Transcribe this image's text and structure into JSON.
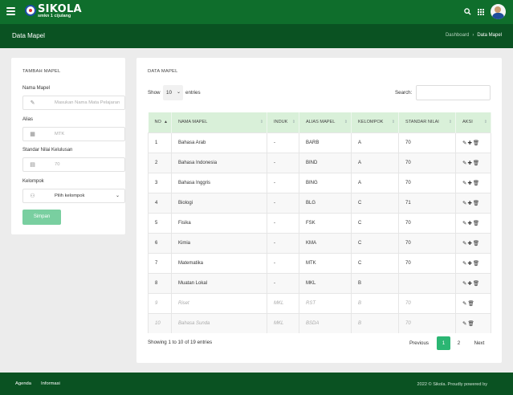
{
  "header": {
    "brand_title": "SIKOLA",
    "brand_subtitle": "smkn 1 cijulang"
  },
  "subheader": {
    "page_title": "Data Mapel",
    "breadcrumb": [
      "Dashboard",
      "Data Mapel"
    ]
  },
  "form": {
    "title": "TAMBAH MAPEL",
    "nama_label": "Nama Mapel",
    "nama_placeholder": "Masukan Nama Mata Pelajaran",
    "alias_label": "Alias",
    "alias_placeholder": "MTK",
    "standar_label": "Standar Nilai Kelulusan",
    "standar_placeholder": "70",
    "kelompok_label": "Kelompok",
    "kelompok_selected": "Pilih kelompok",
    "submit_label": "Simpan"
  },
  "table_card": {
    "title": "DATA MAPEL",
    "show_label": "Show",
    "length_value": "10",
    "entries_label": "entries",
    "search_label": "Search:",
    "columns": [
      "NO",
      "NAMA MAPEL",
      "INDUK",
      "ALIAS MAPEL",
      "KELOMPOK",
      "STANDAR NILAI",
      "AKSI"
    ],
    "rows": [
      {
        "no": "1",
        "nama": "Bahasa Arab",
        "induk": "-",
        "alias": "BARB",
        "kelompok": "A",
        "standar": "70"
      },
      {
        "no": "2",
        "nama": "Bahasa Indonesia",
        "induk": "-",
        "alias": "BIND",
        "kelompok": "A",
        "standar": "70"
      },
      {
        "no": "3",
        "nama": "Bahasa Inggris",
        "induk": "-",
        "alias": "BING",
        "kelompok": "A",
        "standar": "70"
      },
      {
        "no": "4",
        "nama": "Biologi",
        "induk": "-",
        "alias": "BLG",
        "kelompok": "C",
        "standar": "71"
      },
      {
        "no": "5",
        "nama": "Fisika",
        "induk": "-",
        "alias": "FSK",
        "kelompok": "C",
        "standar": "70"
      },
      {
        "no": "6",
        "nama": "Kimia",
        "induk": "-",
        "alias": "KMA",
        "kelompok": "C",
        "standar": "70"
      },
      {
        "no": "7",
        "nama": "Matematika",
        "induk": "-",
        "alias": "MTK",
        "kelompok": "C",
        "standar": "70"
      },
      {
        "no": "8",
        "nama": "Muatan Lokal",
        "induk": "-",
        "alias": "MKL",
        "kelompok": "B",
        "standar": ""
      },
      {
        "no": "9",
        "nama": "Riset",
        "induk": "MKL",
        "alias": "RST",
        "kelompok": "B",
        "standar": "70"
      },
      {
        "no": "10",
        "nama": "Bahasa Sunda",
        "induk": "MKL",
        "alias": "BSDA",
        "kelompok": "B",
        "standar": "70"
      }
    ],
    "info": "Showing 1 to 10 of 19 entries",
    "pagination": {
      "previous": "Previous",
      "page1": "1",
      "page2": "2",
      "next": "Next"
    }
  },
  "footer": {
    "link1": "Agenda",
    "link2": "Informasi",
    "copyright": "2022 © Sikola. Proudly powered by"
  },
  "colors": {
    "topbar": "#0f6e2c",
    "subheader": "#0a5222",
    "table_header": "#d9f0d9",
    "submit_button": "#79cfa0",
    "active_page": "#2bb673"
  }
}
